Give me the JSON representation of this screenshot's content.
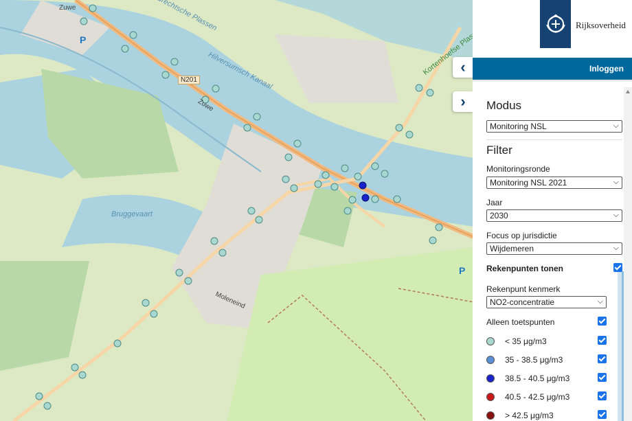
{
  "map": {
    "labels": {
      "zuwe": "Zuwe",
      "loenderveense": "Loosdrechtsche Plassen",
      "hilversumsch_kanaal": "Hilversumsch Kanaal",
      "kortenhoefse": "Kortenhoefse Plassen",
      "bruggevaart": "Bruggevaart",
      "moleneind": "Moleneind",
      "zuwe_road": "Zuwe"
    },
    "road_number": "N201",
    "parking": "P",
    "collapse_icon": "chevron-left-icon",
    "expand_icon": "chevron-right-icon"
  },
  "header": {
    "logo_text": "Rijksoverheid",
    "login": "Inloggen",
    "logo_color": "#154273",
    "bar_color": "#01689b"
  },
  "panel": {
    "modus_title": "Modus",
    "modus_value": "Monitoring NSL",
    "filter_title": "Filter",
    "ronde_label": "Monitoringsronde",
    "ronde_value": "Monitoring NSL 2021",
    "jaar_label": "Jaar",
    "jaar_value": "2030",
    "focus_label": "Focus op jurisdictie",
    "focus_value": "Wijdemeren",
    "rekenpunten_label": "Rekenpunten tonen",
    "kenmerk_label": "Rekenpunt kenmerk",
    "kenmerk_value": "NO2-concentratie",
    "toetspunten_label": "Alleen toetspunten",
    "legend": [
      {
        "label": "< 35 μg/m3",
        "color": "#a9d8d0"
      },
      {
        "label": "35 - 38.5 μg/m3",
        "color": "#5b8fd6"
      },
      {
        "label": "38.5 - 40.5 μg/m3",
        "color": "#1a23c8"
      },
      {
        "label": "40.5 - 42.5 μg/m3",
        "color": "#c81818"
      },
      {
        "label": "> 42.5 μg/m3",
        "color": "#8b1010"
      }
    ]
  }
}
